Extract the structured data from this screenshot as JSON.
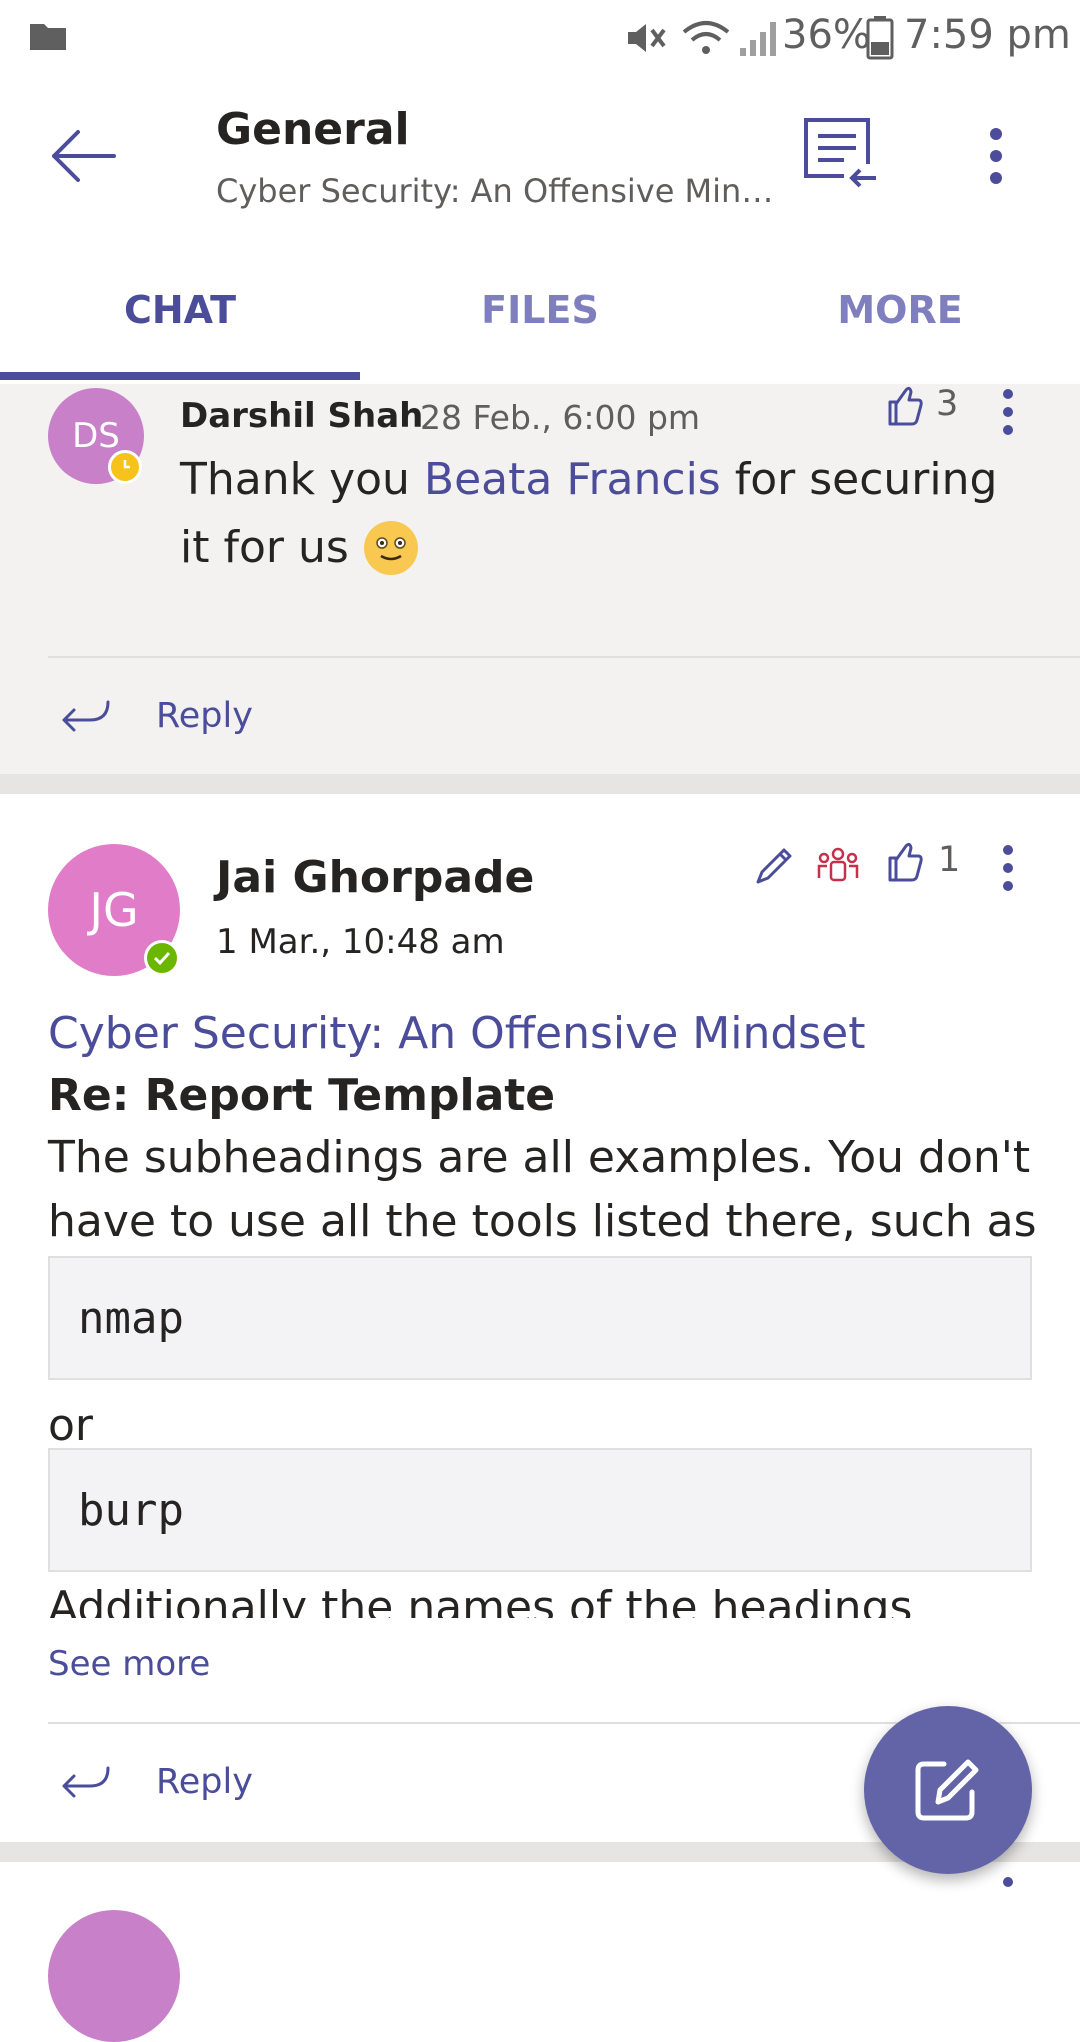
{
  "status_bar": {
    "battery": "36%",
    "time": "7:59 pm"
  },
  "header": {
    "title": "General",
    "subtitle": "Cyber Security: An Offensive Min…"
  },
  "tabs": [
    {
      "label": "CHAT",
      "active": true
    },
    {
      "label": "FILES",
      "active": false
    },
    {
      "label": "MORE",
      "active": false
    }
  ],
  "messages": [
    {
      "initials": "DS",
      "author": "Darshil Shah",
      "time": "28 Feb., 6:00 pm",
      "likes": "3",
      "text_before": "Thank you ",
      "mention": "Beata Francis",
      "text_after_line1": " for securing",
      "text_line2": "it for us",
      "reply_label": "Reply",
      "avatar_color": "#c880c8",
      "status_color": "#f8c21c"
    },
    {
      "initials": "JG",
      "author": "Jai Ghorpade",
      "time": "1 Mar., 10:48 am",
      "likes": "1",
      "channel_link": "Cyber Security: An Offensive Mindset",
      "subject": "Re: Report Template",
      "body_line1": "The subheadings are all examples. You don't",
      "body_line2": "have to use all the tools listed there, such as",
      "code1": "nmap",
      "connector": "or",
      "code2": "burp",
      "truncated_line": "Additionally the names of the headings",
      "see_more": "See more",
      "reply_label": "Reply",
      "avatar_color": "#e07cc8",
      "status_color": "#6bb700"
    }
  ],
  "colors": {
    "brand": "#6264a7",
    "accent_text": "#4b4d9a",
    "card_bg_gray": "#f3f2f1"
  }
}
